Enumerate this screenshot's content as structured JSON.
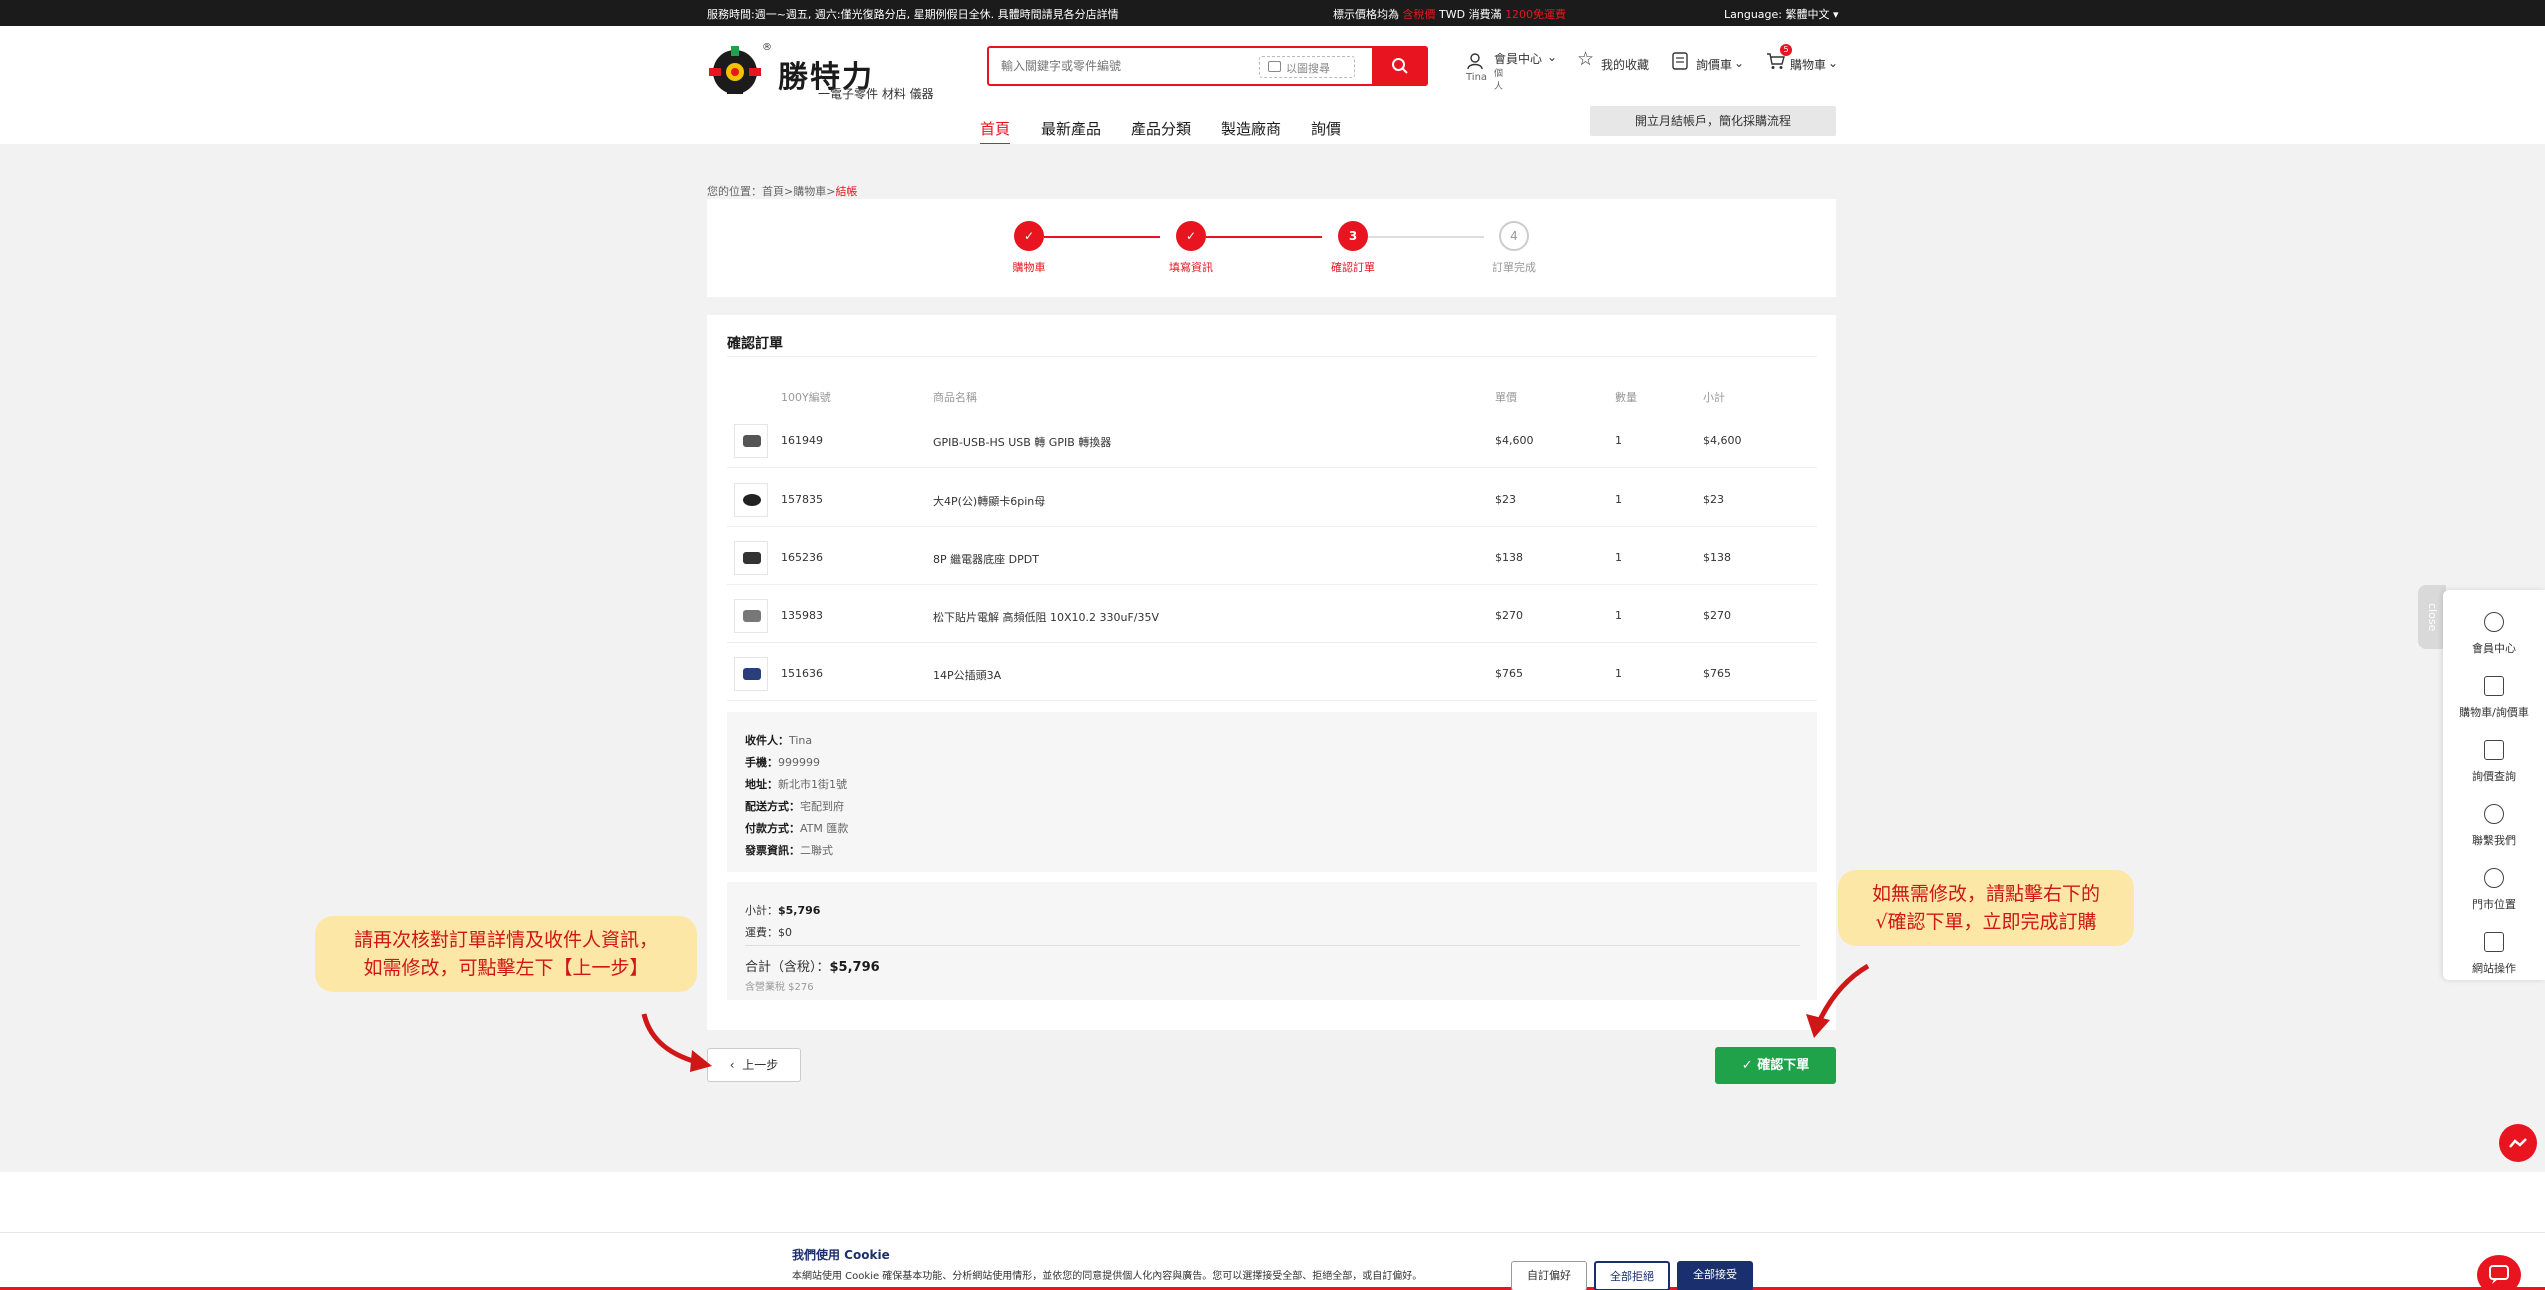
{
  "topbar": {
    "service_hours": "服務時間:週一~週五, 週六:僅光復路分店, 星期例假日全休. 具體時間請見各分店詳情",
    "price_note_pre": "標示價格均為",
    "price_note_tax": "含稅價",
    "price_note_mid": "TWD 消費滿",
    "price_note_free": "1200免運費",
    "language": "Language: 繁體中文"
  },
  "header": {
    "brand": "勝特力",
    "brand_sub": "一電子零件 材料 儀器",
    "search_placeholder": "輸入關鍵字或零件編號",
    "image_search": "以圖搜尋",
    "member_center": "會員中心",
    "member_name": "Tina",
    "member_type": "個人",
    "favorites": "我的收藏",
    "quote_cart": "詢價車",
    "cart": "購物車",
    "cart_count": "5"
  },
  "nav": {
    "items": [
      "首頁",
      "最新產品",
      "產品分類",
      "製造廠商",
      "詢價"
    ],
    "promo": "開立月結帳戶，簡化採購流程"
  },
  "breadcrumb": {
    "prefix": "您的位置：首頁>購物車>",
    "current": "結帳"
  },
  "steps": [
    {
      "num": "✓",
      "label": "購物車"
    },
    {
      "num": "✓",
      "label": "填寫資訊"
    },
    {
      "num": "3",
      "label": "確認訂單"
    },
    {
      "num": "4",
      "label": "訂單完成"
    }
  ],
  "order": {
    "title": "確認訂單",
    "headers": [
      "100Y編號",
      "商品名稱",
      "單價",
      "數量",
      "小計"
    ],
    "rows": [
      {
        "code": "161949",
        "name": "GPIB-USB-HS USB 轉 GPIB 轉換器",
        "price": "$4,600",
        "qty": "1",
        "subtotal": "$4,600"
      },
      {
        "code": "157835",
        "name": "大4P(公)轉顯卡6pin母",
        "price": "$23",
        "qty": "1",
        "subtotal": "$23"
      },
      {
        "code": "165236",
        "name": "8P 繼電器底座 DPDT",
        "price": "$138",
        "qty": "1",
        "subtotal": "$138"
      },
      {
        "code": "135983",
        "name": "松下貼片電解 高頻低阻 10X10.2 330uF/35V",
        "price": "$270",
        "qty": "1",
        "subtotal": "$270"
      },
      {
        "code": "151636",
        "name": "14P公插頭3A",
        "price": "$765",
        "qty": "1",
        "subtotal": "$765"
      }
    ]
  },
  "recipient": {
    "name_label": "收件人：",
    "name": "Tina",
    "phone_label": "手機：",
    "phone": "999999",
    "address_label": "地址：",
    "address": "新北市1街1號",
    "shipping_label": "配送方式：",
    "shipping": "宅配到府",
    "payment_label": "付款方式：",
    "payment": "ATM 匯款",
    "invoice_label": "發票資訊：",
    "invoice": "二聯式"
  },
  "summary": {
    "subtotal_label": "小計：",
    "subtotal": "$5,796",
    "shipping_label": "運費：",
    "shipping": "$0",
    "total_label": "合計（含稅）：",
    "total": "$5,796",
    "tax_note": "含營業稅 $276"
  },
  "buttons": {
    "prev": "上一步",
    "confirm": "確認下單"
  },
  "annotations": {
    "left_line1": "請再次核對訂單詳情及收件人資訊，",
    "left_line2": "如需修改，可點擊左下【上一步】",
    "right_line1": "如無需修改，請點擊右下的",
    "right_line2": "√確認下單，立即完成訂購"
  },
  "side_panel": {
    "close": "close",
    "items": [
      "會員中心",
      "購物車/詢價車",
      "詢價查詢",
      "聯繫我們",
      "門市位置",
      "網站操作"
    ]
  },
  "cookie": {
    "title": "我們使用 Cookie",
    "text": "本網站使用 Cookie 確保基本功能、分析網站使用情形，並依您的同意提供個人化內容與廣告。您可以選擇接受全部、拒絕全部，或自訂偏好。",
    "customize": "自訂偏好",
    "reject_all": "全部拒絕",
    "accept_all": "全部接受"
  },
  "colors": {
    "brand_red": "#e8141f",
    "confirm_green": "#1fa24a",
    "cookie_navy": "#1a2f6e",
    "annotation_bg": "#fde7a6"
  }
}
